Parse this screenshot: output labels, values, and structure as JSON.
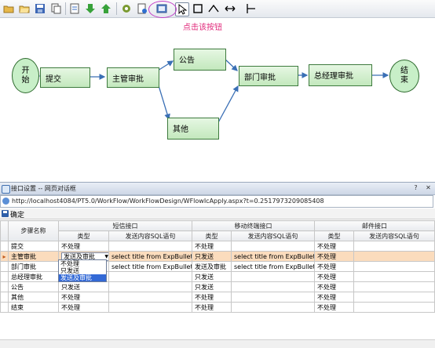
{
  "toolbar": {
    "icons": [
      "folder-icon",
      "open-icon",
      "save-icon",
      "copy-icon",
      "export-icon",
      "down-arrow-icon",
      "up-arrow-icon",
      "settings-icon",
      "document-icon",
      "interface-icon",
      "pointer-icon",
      "rectangle-icon",
      "polyline-icon",
      "double-arrow-icon",
      "tee-icon"
    ],
    "annotation": "点击该按钮"
  },
  "workflow": {
    "nodes": {
      "start": "开始",
      "submit": "提交",
      "supervisor": "主管审批",
      "public": "公告",
      "other": "其他",
      "department": "部门审批",
      "gm": "总经理审批",
      "end": "结束"
    }
  },
  "dialog": {
    "title": "接口设置 -- 网页对话框",
    "url": "http://localhost4084/PT5.0/WorkFlow/WorkFlowDesign/WFlowIcApply.aspx?t=0.2517973209085408",
    "ok_label": "确定",
    "headers": {
      "step_name": "步骤名称",
      "sms": "短信接口",
      "mobile": "移动终端接口",
      "mail": "邮件接口",
      "type": "类型",
      "sql": "发送内容SQL语句"
    },
    "rows": [
      {
        "name": "提交",
        "sms_type": "不处理",
        "sms_sql": "",
        "mobile_type": "不处理",
        "mobile_sql": "",
        "mail_type": "不处理",
        "mail_sql": ""
      },
      {
        "name": "主管审批",
        "sms_type": "发送及审批",
        "sms_sql": "select title from ExpBulletin ...",
        "mobile_type": "只发送",
        "mobile_sql": "select title from ExpBulletin ...",
        "mail_type": "不处理",
        "mail_sql": ""
      },
      {
        "name": "部门审批",
        "sms_type": "",
        "sms_sql": "select title from ExpBulletin ...",
        "mobile_type": "发送及审批",
        "mobile_sql": "select title from ExpBulletin ...",
        "mail_type": "不处理",
        "mail_sql": ""
      },
      {
        "name": "总经理审批",
        "sms_type": "",
        "sms_sql": "",
        "mobile_type": "只发送",
        "mobile_sql": "",
        "mail_type": "不处理",
        "mail_sql": ""
      },
      {
        "name": "公告",
        "sms_type": "只发送",
        "sms_sql": "",
        "mobile_type": "只发送",
        "mobile_sql": "",
        "mail_type": "不处理",
        "mail_sql": ""
      },
      {
        "name": "其他",
        "sms_type": "不处理",
        "sms_sql": "",
        "mobile_type": "不处理",
        "mobile_sql": "",
        "mail_type": "不处理",
        "mail_sql": ""
      },
      {
        "name": "结束",
        "sms_type": "不处理",
        "sms_sql": "",
        "mobile_type": "不处理",
        "mobile_sql": "",
        "mail_type": "不处理",
        "mail_sql": ""
      }
    ],
    "dropdown_options": [
      "不处理",
      "只发送",
      "发送及审批"
    ],
    "dropdown_selected": "发送及审批"
  }
}
